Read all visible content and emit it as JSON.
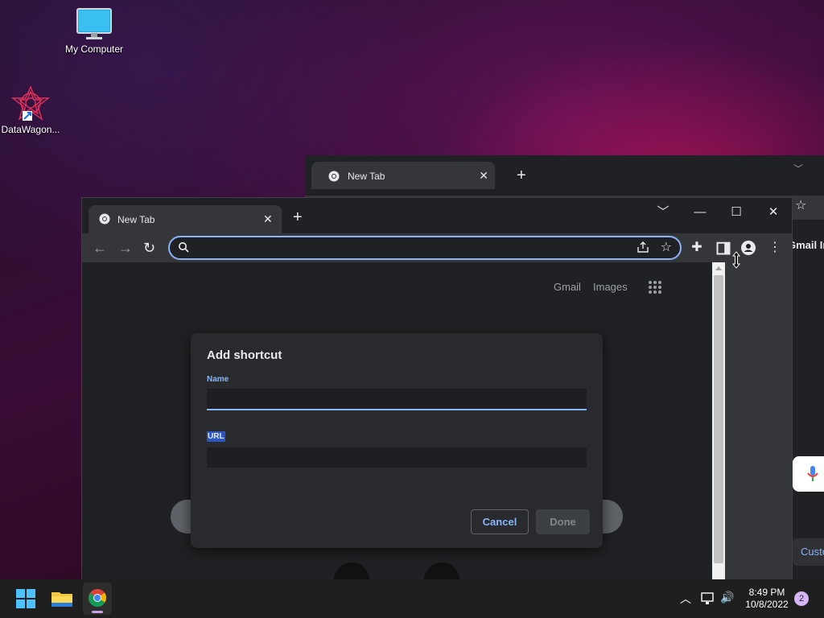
{
  "desktop": {
    "icons": [
      {
        "label": "My Computer"
      },
      {
        "label": "DataWagon..."
      }
    ]
  },
  "background_window": {
    "tab_title": "New Tab",
    "links_partial": "Gmail  Im",
    "customize_partial": "Custo"
  },
  "browser": {
    "tab_title": "New Tab",
    "omnibox": {
      "value": "",
      "placeholder": ""
    },
    "header_links": {
      "gmail": "Gmail",
      "images": "Images"
    }
  },
  "dialog": {
    "title": "Add shortcut",
    "name_label": "Name",
    "name_value": "",
    "url_label": "URL",
    "url_value": "",
    "cancel_label": "Cancel",
    "done_label": "Done"
  },
  "taskbar": {
    "time": "8:49 PM",
    "date": "10/8/2022",
    "notification_count": "2"
  },
  "colors": {
    "accent": "#8ab4f8",
    "chrome_dark": "#202124",
    "chrome_toolbar": "#35363a",
    "taskbar": "#1f1f1f"
  }
}
